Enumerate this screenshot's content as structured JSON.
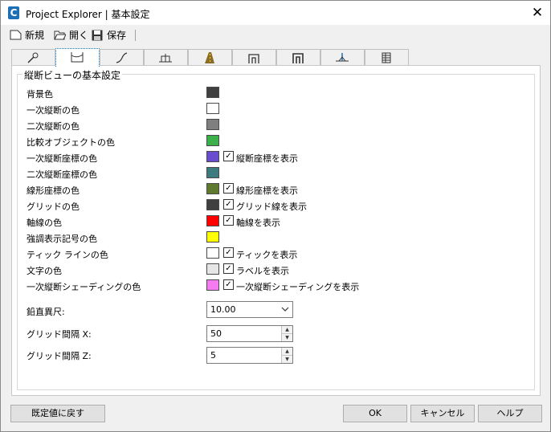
{
  "window": {
    "title": "Project Explorer | 基本設定",
    "app_icon_letter": "C"
  },
  "toolbar": {
    "new_label": "新規",
    "open_label": "開く",
    "save_label": "保存"
  },
  "tabs": [
    {
      "icon": "wrench-icon"
    },
    {
      "icon": "profile-view-icon",
      "active": true
    },
    {
      "icon": "alignment-icon"
    },
    {
      "icon": "cross-section-icon"
    },
    {
      "icon": "road-icon"
    },
    {
      "icon": "structure-icon"
    },
    {
      "icon": "structure2-icon"
    },
    {
      "icon": "axis-icon"
    },
    {
      "icon": "table-icon"
    }
  ],
  "group": {
    "title": "縦断ビューの基本設定",
    "rows": [
      {
        "label": "背景色",
        "color": "#404040"
      },
      {
        "label": "一次縦断の色",
        "color": "#ffffff"
      },
      {
        "label": "二次縦断の色",
        "color": "#7f7f7f"
      },
      {
        "label": "比較オブジェクトの色",
        "color": "#3cb04a"
      },
      {
        "label": "一次縦断座標の色",
        "color": "#6a4ccf",
        "checkbox": "縦断座標を表示",
        "checked": true
      },
      {
        "label": "二次縦断座標の色",
        "color": "#3e7b7f"
      },
      {
        "label": "線形座標の色",
        "color": "#5f7a2f",
        "checkbox": "線形座標を表示",
        "checked": true
      },
      {
        "label": "グリッドの色",
        "color": "#404040",
        "checkbox": "グリッド線を表示",
        "checked": true
      },
      {
        "label": "軸線の色",
        "color": "#ff0000",
        "checkbox": "軸線を表示",
        "checked": true
      },
      {
        "label": "強調表示記号の色",
        "color": "#ffff00"
      },
      {
        "label": "ティック ラインの色",
        "color": "#ffffff",
        "checkbox": "ティックを表示",
        "checked": true
      },
      {
        "label": "文字の色",
        "color": "#e6e6e6",
        "checkbox": "ラベルを表示",
        "checked": true
      },
      {
        "label": "一次縦断シェーディングの色",
        "color": "#f57cf0",
        "checkbox": "一次縦断シェーディングを表示",
        "checked": true
      }
    ],
    "vertical_exaggeration": {
      "label": "鉛直異尺:",
      "value": "10.00"
    },
    "grid_x": {
      "label": "グリッド間隔 X:",
      "value": "50"
    },
    "grid_z": {
      "label": "グリッド間隔 Z:",
      "value": "5"
    }
  },
  "buttons": {
    "reset": "既定値に戻す",
    "ok": "OK",
    "cancel": "キャンセル",
    "help": "ヘルプ"
  },
  "check_glyph": "✓"
}
